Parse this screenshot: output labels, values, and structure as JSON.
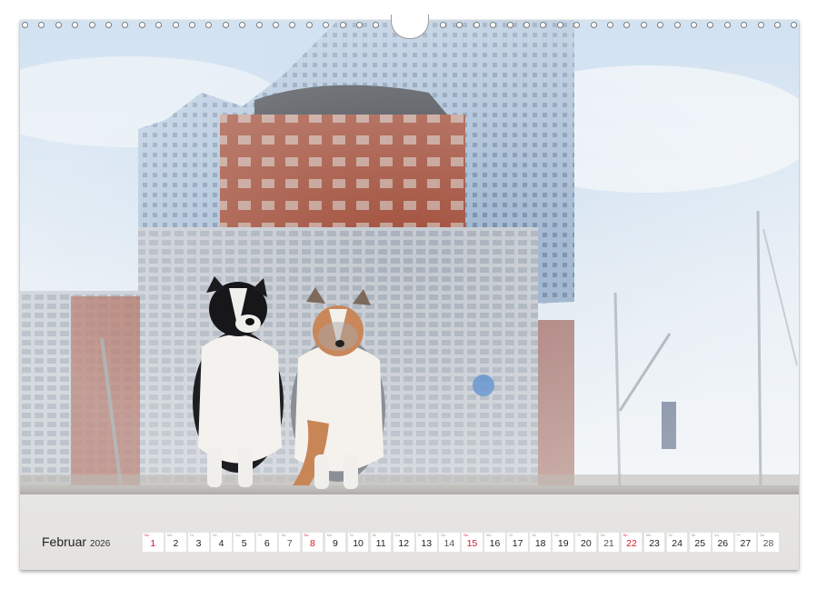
{
  "calendar": {
    "month": "Februar",
    "year": "2026",
    "days": [
      {
        "weekday": "So",
        "day": "1",
        "type": "sunday"
      },
      {
        "weekday": "Mo",
        "day": "2",
        "type": "weekday"
      },
      {
        "weekday": "Di",
        "day": "3",
        "type": "weekday"
      },
      {
        "weekday": "Mi",
        "day": "4",
        "type": "weekday"
      },
      {
        "weekday": "Do",
        "day": "5",
        "type": "weekday"
      },
      {
        "weekday": "Fr",
        "day": "6",
        "type": "weekday"
      },
      {
        "weekday": "Sa",
        "day": "7",
        "type": "saturday"
      },
      {
        "weekday": "So",
        "day": "8",
        "type": "sunday"
      },
      {
        "weekday": "Mo",
        "day": "9",
        "type": "weekday"
      },
      {
        "weekday": "Di",
        "day": "10",
        "type": "weekday"
      },
      {
        "weekday": "Mi",
        "day": "11",
        "type": "weekday"
      },
      {
        "weekday": "Do",
        "day": "12",
        "type": "weekday"
      },
      {
        "weekday": "Fr",
        "day": "13",
        "type": "weekday"
      },
      {
        "weekday": "Sa",
        "day": "14",
        "type": "saturday"
      },
      {
        "weekday": "So",
        "day": "15",
        "type": "sunday"
      },
      {
        "weekday": "Mo",
        "day": "16",
        "type": "weekday"
      },
      {
        "weekday": "Di",
        "day": "17",
        "type": "weekday"
      },
      {
        "weekday": "Mi",
        "day": "18",
        "type": "weekday"
      },
      {
        "weekday": "Do",
        "day": "19",
        "type": "weekday"
      },
      {
        "weekday": "Fr",
        "day": "20",
        "type": "weekday"
      },
      {
        "weekday": "Sa",
        "day": "21",
        "type": "saturday"
      },
      {
        "weekday": "So",
        "day": "22",
        "type": "sunday"
      },
      {
        "weekday": "Mo",
        "day": "23",
        "type": "weekday"
      },
      {
        "weekday": "Di",
        "day": "24",
        "type": "weekday"
      },
      {
        "weekday": "Mi",
        "day": "25",
        "type": "weekday"
      },
      {
        "weekday": "Do",
        "day": "26",
        "type": "weekday"
      },
      {
        "weekday": "Fr",
        "day": "27",
        "type": "weekday"
      },
      {
        "weekday": "Sa",
        "day": "28",
        "type": "saturday"
      }
    ]
  },
  "colors": {
    "sunday": "#d4182c",
    "sky": "#cfe0ef",
    "brick": "#a84a38",
    "glass": "#9fb6cf"
  },
  "photo": {
    "subject": "two-shelties-in-front-of-elbphilharmonie"
  }
}
